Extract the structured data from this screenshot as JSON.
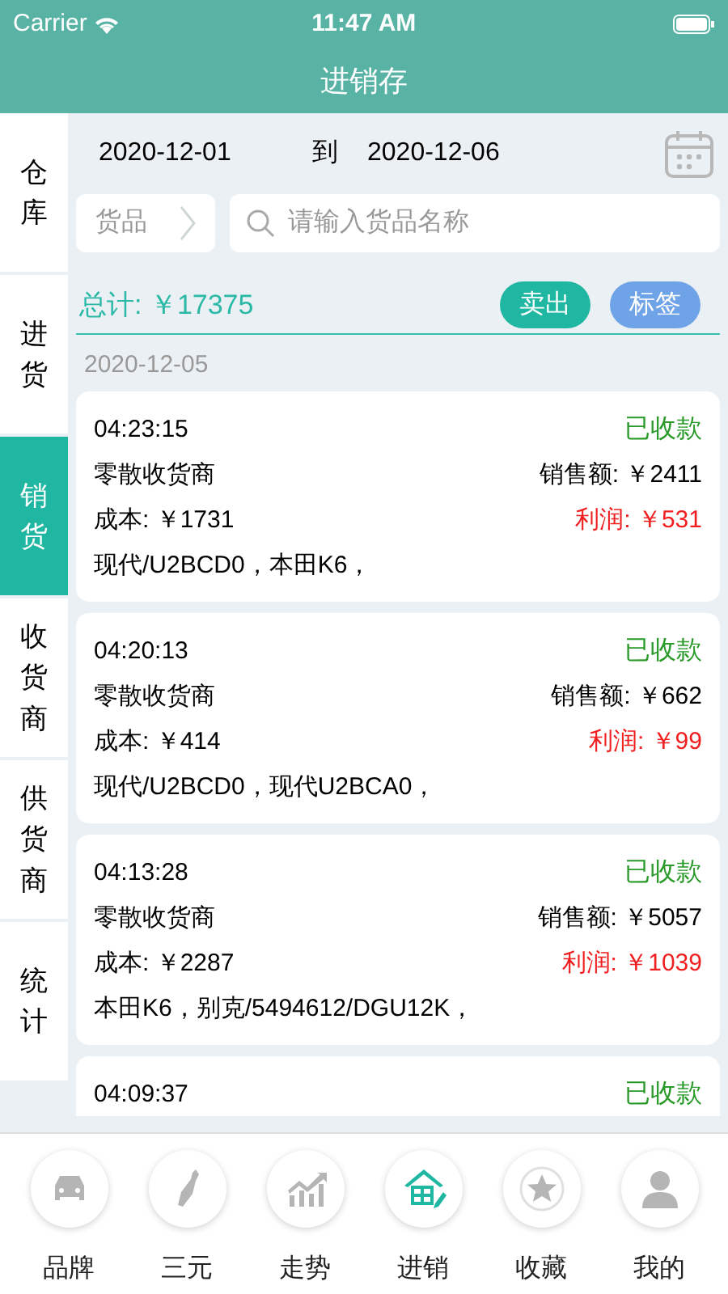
{
  "status_bar": {
    "carrier": "Carrier",
    "time": "11:47 AM"
  },
  "header": {
    "title": "进销存"
  },
  "sidebar": [
    {
      "label": "仓库",
      "selected": false
    },
    {
      "label": "进货",
      "selected": false
    },
    {
      "label": "销货",
      "selected": true
    },
    {
      "label": "收货商",
      "selected": false
    },
    {
      "label": "供货商",
      "selected": false
    },
    {
      "label": "统计",
      "selected": false
    }
  ],
  "date_range": {
    "start": "2020-12-01",
    "separator": "到",
    "end": "2020-12-06"
  },
  "filter": {
    "category": "货品",
    "search_placeholder": "请输入货品名称"
  },
  "summary": {
    "total": "总计: ￥17375",
    "buttons": [
      {
        "label": "卖出",
        "color": "#1fb7a2"
      },
      {
        "label": "标签",
        "color": "#6fa3e8"
      }
    ]
  },
  "date_group": "2020-12-05",
  "orders": [
    {
      "time": "04:23:15",
      "status": "已收款",
      "customer": "零散收货商",
      "sales": "销售额: ￥2411",
      "cost": "成本: ￥1731",
      "profit": "利润: ￥531",
      "items": "现代/U2BCD0，本田K6，"
    },
    {
      "time": "04:20:13",
      "status": "已收款",
      "customer": "零散收货商",
      "sales": "销售额: ￥662",
      "cost": "成本: ￥414",
      "profit": "利润: ￥99",
      "items": "现代/U2BCD0，现代U2BCA0，"
    },
    {
      "time": "04:13:28",
      "status": "已收款",
      "customer": "零散收货商",
      "sales": "销售额: ￥5057",
      "cost": "成本: ￥2287",
      "profit": "利润: ￥1039",
      "items": "本田K6，别克/5494612/DGU12K，"
    },
    {
      "time": "04:09:37",
      "status": "已收款"
    }
  ],
  "tab_bar": [
    {
      "label": "品牌",
      "selected": false
    },
    {
      "label": "三元",
      "selected": false
    },
    {
      "label": "走势",
      "selected": false
    },
    {
      "label": "进销",
      "selected": true
    },
    {
      "label": "收藏",
      "selected": false
    },
    {
      "label": "我的",
      "selected": false
    }
  ]
}
